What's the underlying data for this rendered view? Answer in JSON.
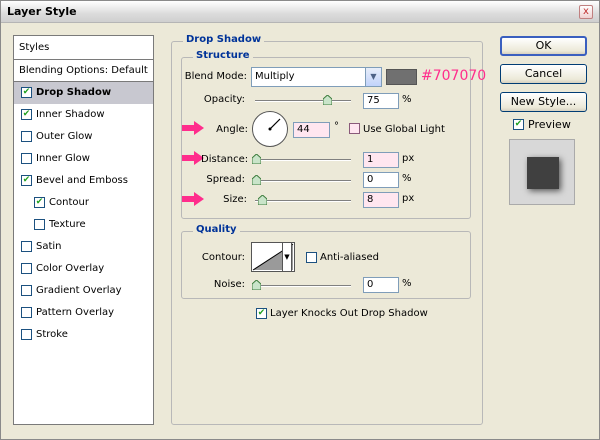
{
  "window": {
    "title": "Layer Style",
    "close": "x"
  },
  "styles_panel": {
    "header": "Styles",
    "blending_options": "Blending Options: Default",
    "items": [
      {
        "label": "Drop Shadow",
        "checked": true,
        "selected": true,
        "sub": false
      },
      {
        "label": "Inner Shadow",
        "checked": true,
        "selected": false,
        "sub": false
      },
      {
        "label": "Outer Glow",
        "checked": false,
        "selected": false,
        "sub": false
      },
      {
        "label": "Inner Glow",
        "checked": false,
        "selected": false,
        "sub": false
      },
      {
        "label": "Bevel and Emboss",
        "checked": true,
        "selected": false,
        "sub": false
      },
      {
        "label": "Contour",
        "checked": true,
        "selected": false,
        "sub": true
      },
      {
        "label": "Texture",
        "checked": false,
        "selected": false,
        "sub": true
      },
      {
        "label": "Satin",
        "checked": false,
        "selected": false,
        "sub": false
      },
      {
        "label": "Color Overlay",
        "checked": false,
        "selected": false,
        "sub": false
      },
      {
        "label": "Gradient Overlay",
        "checked": false,
        "selected": false,
        "sub": false
      },
      {
        "label": "Pattern Overlay",
        "checked": false,
        "selected": false,
        "sub": false
      },
      {
        "label": "Stroke",
        "checked": false,
        "selected": false,
        "sub": false
      }
    ]
  },
  "drop_shadow": {
    "group_title": "Drop Shadow",
    "structure": {
      "title": "Structure",
      "blend_mode_label": "Blend Mode:",
      "blend_mode_value": "Multiply",
      "shadow_color": "#707070",
      "color_annotation": "#707070",
      "opacity_label": "Opacity:",
      "opacity_value": "75",
      "opacity_level": 0.75,
      "opacity_unit": "%",
      "angle_label": "Angle:",
      "angle_value": "44",
      "angle_unit": "°",
      "use_global_light_label": "Use Global Light",
      "use_global_light_checked": false,
      "distance_label": "Distance:",
      "distance_value": "1",
      "distance_unit": "px",
      "spread_label": "Spread:",
      "spread_value": "0",
      "spread_unit": "%",
      "size_label": "Size:",
      "size_value": "8",
      "size_unit": "px"
    },
    "quality": {
      "title": "Quality",
      "contour_label": "Contour:",
      "anti_aliased_label": "Anti-aliased",
      "anti_aliased_checked": false,
      "noise_label": "Noise:",
      "noise_value": "0",
      "noise_unit": "%"
    },
    "knockout_label": "Layer Knocks Out Drop Shadow",
    "knockout_checked": true
  },
  "buttons": {
    "ok": "OK",
    "cancel": "Cancel",
    "new_style": "New Style...",
    "preview_label": "Preview",
    "preview_checked": true
  },
  "colors": {
    "highlight_arrow": "#ff2d8c",
    "group_title": "#003399"
  }
}
